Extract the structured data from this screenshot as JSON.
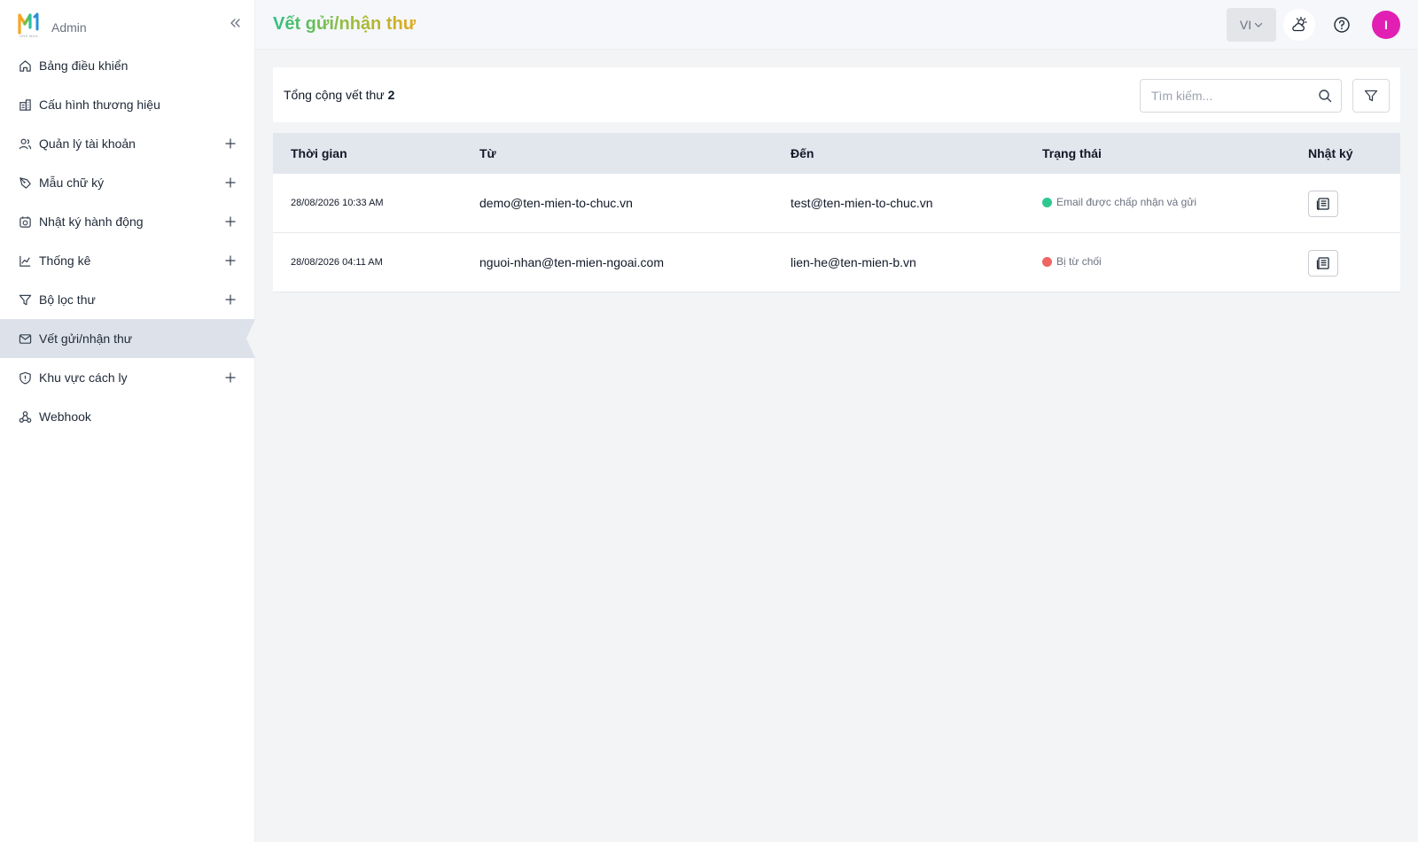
{
  "sidebar": {
    "brand_role": "Admin",
    "logo_word": "ONE MAIL",
    "items": [
      {
        "label": "Bảng điều khiển",
        "icon": "home-icon",
        "expandable": false
      },
      {
        "label": "Cấu hình thương hiệu",
        "icon": "building-icon",
        "expandable": false
      },
      {
        "label": "Quản lý tài khoản",
        "icon": "users-icon",
        "expandable": true
      },
      {
        "label": "Mẫu chữ ký",
        "icon": "pen-nib-icon",
        "expandable": true
      },
      {
        "label": "Nhật ký hành động",
        "icon": "history-icon",
        "expandable": true
      },
      {
        "label": "Thống kê",
        "icon": "chart-icon",
        "expandable": true
      },
      {
        "label": "Bộ lọc thư",
        "icon": "filter-icon",
        "expandable": true
      },
      {
        "label": "Vết gửi/nhận thư",
        "icon": "mail-icon",
        "expandable": false,
        "active": true
      },
      {
        "label": "Khu vực cách ly",
        "icon": "shield-icon",
        "expandable": true
      },
      {
        "label": "Webhook",
        "icon": "webhook-icon",
        "expandable": false
      }
    ]
  },
  "header": {
    "title": "Vết gửi/nhận thư",
    "language": "VI",
    "avatar_initial": "I"
  },
  "toolbar": {
    "total_label": "Tổng cộng vết thư",
    "total_count": "2",
    "search_placeholder": "Tìm kiếm..."
  },
  "table": {
    "columns": [
      "Thời gian",
      "Từ",
      "Đến",
      "Trạng thái",
      "Nhật ký"
    ],
    "rows": [
      {
        "time": "28/08/2026 10:33 AM",
        "from": "demo@ten-mien-to-chuc.vn",
        "to": "test@ten-mien-to-chuc.vn",
        "status": "Email được chấp nhận và gửi",
        "status_color": "#2ec990"
      },
      {
        "time": "28/08/2026 04:11 AM",
        "from": "nguoi-nhan@ten-mien-ngoai.com",
        "to": "lien-he@ten-mien-b.vn",
        "status": "Bị từ chối",
        "status_color": "#ef6464"
      }
    ]
  },
  "colors": {
    "accent_gradient": [
      "#2fbf7f",
      "#e3a91f"
    ],
    "avatar": "#e11fb3",
    "active_nav": "#dde2ea"
  }
}
